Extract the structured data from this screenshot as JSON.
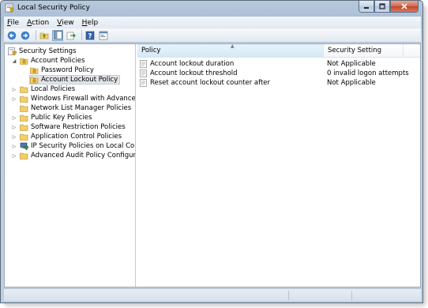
{
  "window": {
    "title": "Local Security Policy",
    "app_icon": "security-policy-icon",
    "controls": {
      "minimize": "minimize-icon",
      "maximize": "maximize-icon",
      "close": "close-icon"
    }
  },
  "menubar": {
    "items": [
      {
        "label": "File",
        "mnemonic": "F"
      },
      {
        "label": "Action",
        "mnemonic": "A"
      },
      {
        "label": "View",
        "mnemonic": "V"
      },
      {
        "label": "Help",
        "mnemonic": "H"
      }
    ]
  },
  "toolbar": {
    "buttons": [
      "back-icon",
      "forward-icon",
      "up-folder-icon",
      "show-hide-tree-icon",
      "export-list-icon",
      "help-icon",
      "properties-icon"
    ]
  },
  "tree": {
    "root": {
      "label": "Security Settings"
    },
    "items": [
      {
        "label": "Account Policies",
        "expanded": true
      },
      {
        "label": "Password Policy"
      },
      {
        "label": "Account Lockout Policy",
        "selected": true
      },
      {
        "label": "Local Policies"
      },
      {
        "label": "Windows Firewall with Advanced Security"
      },
      {
        "label": "Network List Manager Policies"
      },
      {
        "label": "Public Key Policies"
      },
      {
        "label": "Software Restriction Policies"
      },
      {
        "label": "Application Control Policies"
      },
      {
        "label": "IP Security Policies on Local Computer"
      },
      {
        "label": "Advanced Audit Policy Configuration"
      }
    ]
  },
  "list": {
    "columns": [
      "Policy",
      "Security Setting"
    ],
    "sorted_column": "Policy",
    "rows": [
      {
        "policy": "Account lockout duration",
        "setting": "Not Applicable"
      },
      {
        "policy": "Account lockout threshold",
        "setting": "0 invalid logon attempts"
      },
      {
        "policy": "Reset account lockout counter after",
        "setting": "Not Applicable"
      }
    ]
  },
  "colors": {
    "title_bar": "#b7c9dd",
    "close_button": "#c2472e",
    "folder": "#f2cf6a",
    "selection": "#e0e3e8"
  }
}
